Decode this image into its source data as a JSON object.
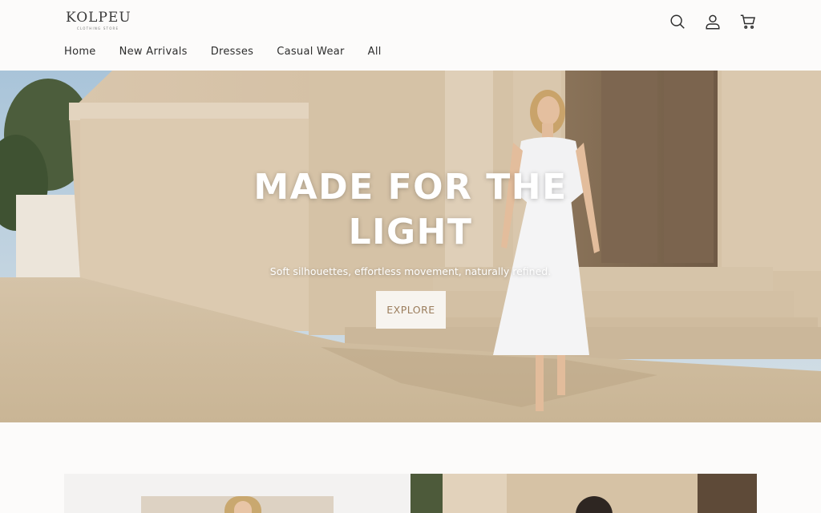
{
  "brand": {
    "name": "KOLPEU",
    "tagline": "CLOTHING STORE"
  },
  "header_icons": [
    "search-icon",
    "account-icon",
    "cart-icon"
  ],
  "nav": {
    "items": [
      "Home",
      "New Arrivals",
      "Dresses",
      "Casual Wear",
      "All"
    ]
  },
  "hero": {
    "title": "MADE FOR THE LIGHT",
    "subtitle": "Soft silhouettes, effortless movement, naturally refined.",
    "cta_label": "EXPLORE"
  },
  "colors": {
    "background": "#fcfbfa",
    "accent": "#9b7d5c",
    "cta_bg": "#f7f4ef"
  }
}
